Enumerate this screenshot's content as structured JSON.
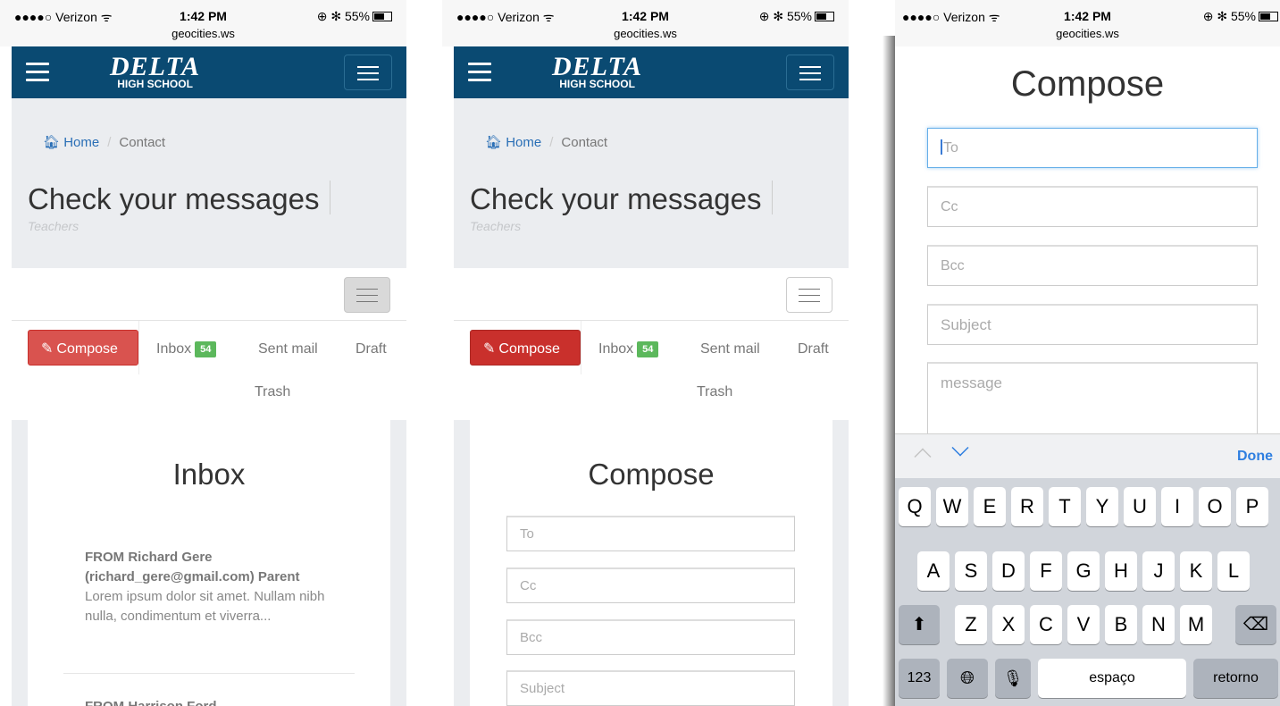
{
  "status_bar": {
    "carrier": "●●●●○ Verizon ᯤ",
    "time": "1:42 PM",
    "right": "⊕ ✻ 55%",
    "url": "geocities.ws"
  },
  "navbar": {
    "logo_big": "DELTA",
    "logo_small": "HIGH SCHOOL",
    "color": "#0a4a72"
  },
  "breadcrumb": {
    "home": "Home",
    "current": "Contact"
  },
  "page": {
    "title": "Check your messages",
    "subtitle": "Teachers"
  },
  "mail_nav": {
    "compose": "Compose",
    "inbox": "Inbox",
    "inbox_count": "54",
    "sent": "Sent mail",
    "draft": "Draft",
    "trash": "Trash"
  },
  "inbox": {
    "title": "Inbox",
    "message1_from": "FROM Richard Gere (richard_gere@gmail.com) Parent",
    "message1_preview": "Lorem ipsum dolor sit amet. Nullam nibh nulla, condimentum et viverra...",
    "message2_from": "FROM Harrison Ford"
  },
  "compose_form": {
    "title": "Compose",
    "to": "To",
    "cc": "Cc",
    "bcc": "Bcc",
    "subject": "Subject",
    "message": "message"
  },
  "keyboard": {
    "done": "Done",
    "row1": [
      "Q",
      "W",
      "E",
      "R",
      "T",
      "Y",
      "U",
      "I",
      "O",
      "P"
    ],
    "row2": [
      "A",
      "S",
      "D",
      "F",
      "G",
      "H",
      "J",
      "K",
      "L"
    ],
    "row3": [
      "Z",
      "X",
      "C",
      "V",
      "B",
      "N",
      "M"
    ],
    "numbers": "123",
    "space": "espaço",
    "return": "retorno"
  },
  "colors": {
    "danger": "#d9534f",
    "badge": "#5cb85c",
    "link": "#2a6fb6",
    "ios_blue": "#2f7fe0"
  }
}
